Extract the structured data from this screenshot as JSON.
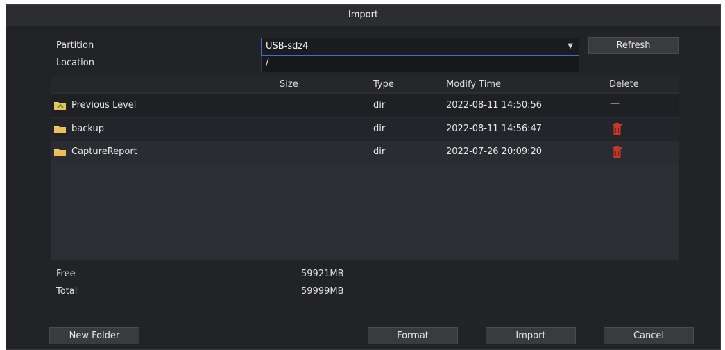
{
  "dialog": {
    "title": "Import"
  },
  "form": {
    "partition_label": "Partition",
    "partition_value": "USB-sdz4",
    "location_label": "Location",
    "location_value": "/",
    "refresh_label": "Refresh"
  },
  "table": {
    "headers": {
      "size": "Size",
      "type": "Type",
      "modify": "Modify Time",
      "delete": "Delete"
    },
    "rows": [
      {
        "name": "Previous Level",
        "size": "",
        "type": "dir",
        "modify": "2022-08-11 14:50:56",
        "delete": "—"
      },
      {
        "name": "backup",
        "size": "",
        "type": "dir",
        "modify": "2022-08-11 14:56:47",
        "delete": "trash-icon"
      },
      {
        "name": "CaptureReport",
        "size": "",
        "type": "dir",
        "modify": "2022-07-26 20:09:20",
        "delete": "trash-icon"
      }
    ]
  },
  "storage": {
    "free_label": "Free",
    "free_value": "59921MB",
    "total_label": "Total",
    "total_value": "59999MB"
  },
  "footer": {
    "new_folder": "New Folder",
    "format": "Format",
    "import": "Import",
    "cancel": "Cancel"
  },
  "colors": {
    "accent": "#3c6fd0",
    "folder": "#f2d27a",
    "trash": "#c0392b",
    "background": "#222326"
  }
}
